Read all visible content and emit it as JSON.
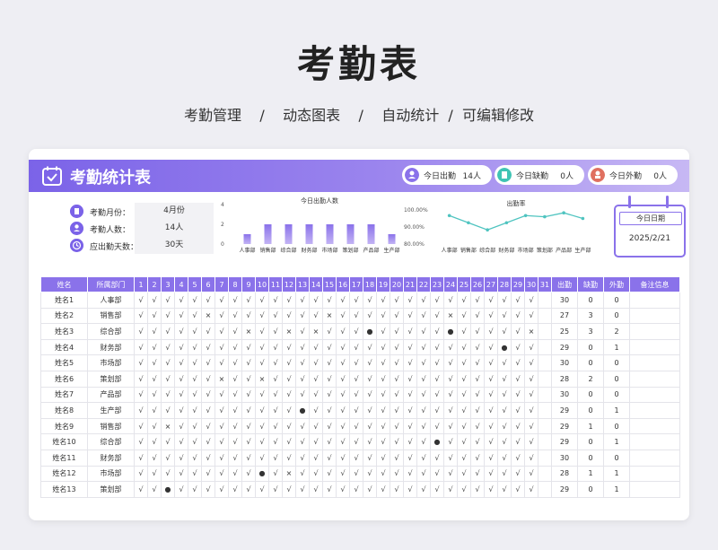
{
  "page": {
    "title": "考勤表",
    "subtitle": "考勤管理    /    动态图表    /    自动统计  /  可编辑修改"
  },
  "header": {
    "title": "考勤统计表",
    "stats": [
      {
        "label": "今日出勤",
        "value": "14人",
        "color": "#8a72ea"
      },
      {
        "label": "今日缺勤",
        "value": "0人",
        "color": "#3fc4b4"
      },
      {
        "label": "今日外勤",
        "value": "0人",
        "color": "#e07060"
      }
    ]
  },
  "info": [
    {
      "label": "考勤月份：",
      "value": "4月份",
      "icon": "document-icon"
    },
    {
      "label": "考勤人数：",
      "value": "14人",
      "icon": "user-icon"
    },
    {
      "label": "应出勤天数：",
      "value": "30天",
      "icon": "clock-icon"
    }
  ],
  "date_widget": {
    "title": "今日日期",
    "value": "2025/2/21"
  },
  "chart_data": [
    {
      "type": "bar",
      "title": "今日出勤人数",
      "categories": [
        "人事部",
        "销售部",
        "综合部",
        "财务部",
        "市场部",
        "策划部",
        "产品部",
        "生产部"
      ],
      "values": [
        1,
        2,
        2,
        2,
        2,
        2,
        2,
        1
      ],
      "ylim": [
        0,
        4
      ],
      "yticks": [
        "0",
        "2",
        "4"
      ],
      "color": "#8a72ea"
    },
    {
      "type": "line",
      "title": "出勤率",
      "categories": [
        "人事部",
        "销售部",
        "综合部",
        "财务部",
        "市场部",
        "策划部",
        "产品部",
        "生产部"
      ],
      "values": [
        96.7,
        92.5,
        88.3,
        92.5,
        96.7,
        96.0,
        98.3,
        95.0
      ],
      "ylim": [
        80,
        100
      ],
      "yticks": [
        "80.00%",
        "90.00%",
        "100.00%"
      ],
      "color": "#4fc4c0"
    }
  ],
  "table": {
    "headers": [
      "姓名",
      "所属部门",
      "1",
      "2",
      "3",
      "4",
      "5",
      "6",
      "7",
      "8",
      "9",
      "10",
      "11",
      "12",
      "13",
      "14",
      "15",
      "16",
      "17",
      "18",
      "19",
      "20",
      "21",
      "22",
      "23",
      "24",
      "25",
      "26",
      "27",
      "28",
      "29",
      "30",
      "31",
      "出勤",
      "缺勤",
      "外勤",
      "备注信息"
    ],
    "rows": [
      {
        "name": "姓名1",
        "dept": "人事部",
        "days": "vvvvvvvvvvvvvvvvvvvvvvvvvvvvvv-",
        "att": "30",
        "abs": "0",
        "out": "0",
        "note": ""
      },
      {
        "name": "姓名2",
        "dept": "销售部",
        "days": "vvvvvxvvvvvvvvxvvvvvvvvxvvvvvv-",
        "att": "27",
        "abs": "3",
        "out": "0",
        "note": ""
      },
      {
        "name": "姓名3",
        "dept": "综合部",
        "days": "vvvvvvvvxvvxvxvvv.vvvvv.vvvvvx-",
        "att": "25",
        "abs": "3",
        "out": "2",
        "note": ""
      },
      {
        "name": "姓名4",
        "dept": "财务部",
        "days": "vvvvvvvvvvvvvvvvvvvvvvvvvvv.vv-",
        "att": "29",
        "abs": "0",
        "out": "1",
        "note": ""
      },
      {
        "name": "姓名5",
        "dept": "市场部",
        "days": "vvvvvvvvvvvvvvvvvvvvvvvvvvvvvv-",
        "att": "30",
        "abs": "0",
        "out": "0",
        "note": ""
      },
      {
        "name": "姓名6",
        "dept": "策划部",
        "days": "vvvvvvxvvxvvvvvvvvvvvvvvvvvvvv-",
        "att": "28",
        "abs": "2",
        "out": "0",
        "note": ""
      },
      {
        "name": "姓名7",
        "dept": "产品部",
        "days": "vvvvvvvvvvvvvvvvvvvvvvvvvvvvvv-",
        "att": "30",
        "abs": "0",
        "out": "0",
        "note": ""
      },
      {
        "name": "姓名8",
        "dept": "生产部",
        "days": "vvvvvvvvvvvv.vvvvvvvvvvvvvvvvv-",
        "att": "29",
        "abs": "0",
        "out": "1",
        "note": ""
      },
      {
        "name": "姓名9",
        "dept": "销售部",
        "days": "vvxvvvvvvvvvvvvvvvvvvvvvvvvvvv-",
        "att": "29",
        "abs": "1",
        "out": "0",
        "note": ""
      },
      {
        "name": "姓名10",
        "dept": "综合部",
        "days": "vvvvvvvvvvvvvvvvvvvvvv.vvvvvvv-",
        "att": "29",
        "abs": "0",
        "out": "1",
        "note": ""
      },
      {
        "name": "姓名11",
        "dept": "财务部",
        "days": "vvvvvvvvvvvvvvvvvvvvvvvvvvvvvv-",
        "att": "30",
        "abs": "0",
        "out": "0",
        "note": ""
      },
      {
        "name": "姓名12",
        "dept": "市场部",
        "days": "vvvvvvvvv.vxvvvvvvvvvvvvvvvvvv-",
        "att": "28",
        "abs": "1",
        "out": "1",
        "note": ""
      },
      {
        "name": "姓名13",
        "dept": "策划部",
        "days": "vv.vvvvvvvvvvvvvvvvvvvvvvvvvvv-",
        "att": "29",
        "abs": "0",
        "out": "1",
        "note": ""
      }
    ]
  },
  "symbols": {
    "v": "√",
    "x": "×",
    ".": "●",
    "-": ""
  }
}
